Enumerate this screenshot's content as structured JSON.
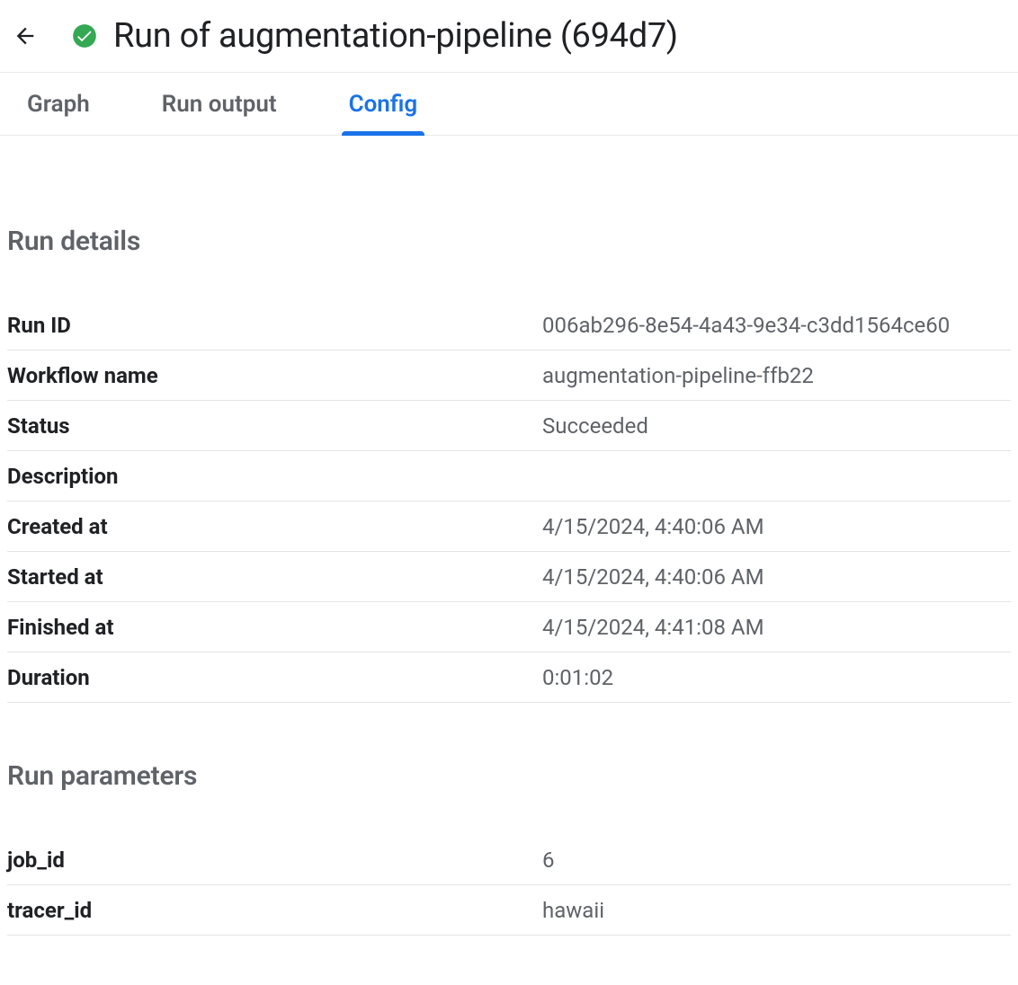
{
  "header": {
    "title": "Run of augmentation-pipeline (694d7)"
  },
  "tabs": {
    "graph": "Graph",
    "run_output": "Run output",
    "config": "Config"
  },
  "sections": {
    "run_details_title": "Run details",
    "run_parameters_title": "Run parameters"
  },
  "run_details": {
    "run_id": {
      "label": "Run ID",
      "value": "006ab296-8e54-4a43-9e34-c3dd1564ce60"
    },
    "workflow_name": {
      "label": "Workflow name",
      "value": "augmentation-pipeline-ffb22"
    },
    "status": {
      "label": "Status",
      "value": "Succeeded"
    },
    "description": {
      "label": "Description",
      "value": ""
    },
    "created_at": {
      "label": "Created at",
      "value": "4/15/2024, 4:40:06 AM"
    },
    "started_at": {
      "label": "Started at",
      "value": "4/15/2024, 4:40:06 AM"
    },
    "finished_at": {
      "label": "Finished at",
      "value": "4/15/2024, 4:41:08 AM"
    },
    "duration": {
      "label": "Duration",
      "value": "0:01:02"
    }
  },
  "run_parameters": {
    "job_id": {
      "label": "job_id",
      "value": "6"
    },
    "tracer_id": {
      "label": "tracer_id",
      "value": "hawaii"
    }
  }
}
